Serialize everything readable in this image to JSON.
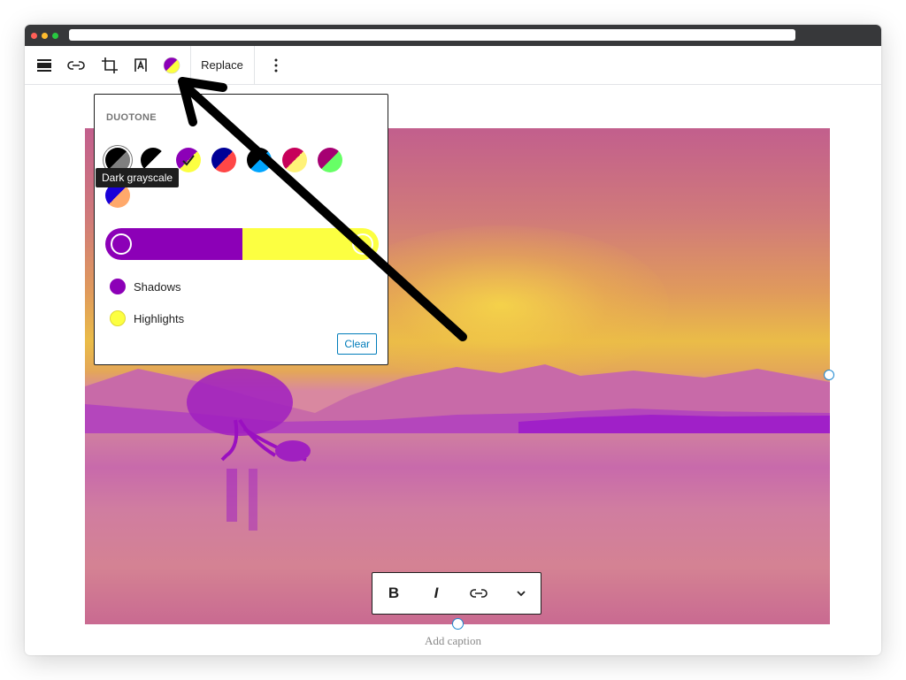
{
  "browser": {
    "traffic_lights": [
      {
        "name": "close",
        "color": "#ff5f57"
      },
      {
        "name": "minimize",
        "color": "#febc2e"
      },
      {
        "name": "maximize",
        "color": "#28c840"
      }
    ],
    "url": ""
  },
  "block_toolbar": {
    "items": [
      {
        "icon": "align-icon",
        "label": "Align"
      },
      {
        "icon": "link-icon",
        "label": "Insert link"
      },
      {
        "icon": "crop-icon",
        "label": "Crop"
      },
      {
        "icon": "text-over-image-icon",
        "label": "Add text over image"
      },
      {
        "icon": "duotone-icon",
        "label": "Apply duotone filter"
      }
    ],
    "replace_label": "Replace",
    "more_icon": "more-vertical-icon"
  },
  "duotone_popover": {
    "title": "DUOTONE",
    "tooltip": "Dark grayscale",
    "presets": [
      {
        "name": "Dark grayscale",
        "shadow": "#000000",
        "highlight": "#7f7f7f",
        "selected": false,
        "hovered": true
      },
      {
        "name": "Grayscale",
        "shadow": "#000000",
        "highlight": "#ffffff",
        "selected": false
      },
      {
        "name": "Purple and yellow",
        "shadow": "#8c00b7",
        "highlight": "#fcff41",
        "selected": true
      },
      {
        "name": "Blue and red",
        "shadow": "#000097",
        "highlight": "#ff4747",
        "selected": false
      },
      {
        "name": "Midnight",
        "shadow": "#000000",
        "highlight": "#00a5ff",
        "selected": false
      },
      {
        "name": "Magenta and yellow",
        "shadow": "#c7005a",
        "highlight": "#fff278",
        "selected": false
      },
      {
        "name": "Purple and green",
        "shadow": "#a60072",
        "highlight": "#67ff66",
        "selected": false
      },
      {
        "name": "Blue and orange",
        "shadow": "#1900d8",
        "highlight": "#ffa96b",
        "selected": false
      }
    ],
    "gradient": {
      "shadow_color": "#8c00b7",
      "highlight_color": "#fcff41"
    },
    "shadows_label": "Shadows",
    "highlights_label": "Highlights",
    "clear_label": "Clear"
  },
  "caption_toolbar": {
    "items": [
      {
        "icon": "bold-icon",
        "label": "B"
      },
      {
        "icon": "italic-icon",
        "label": "I"
      },
      {
        "icon": "link-icon",
        "label": "Link"
      },
      {
        "icon": "chevron-down-icon",
        "label": "More"
      }
    ]
  },
  "caption_placeholder": "Add caption",
  "annotation": {
    "type": "arrow",
    "color": "#000000",
    "points_to": "duotone-icon"
  }
}
